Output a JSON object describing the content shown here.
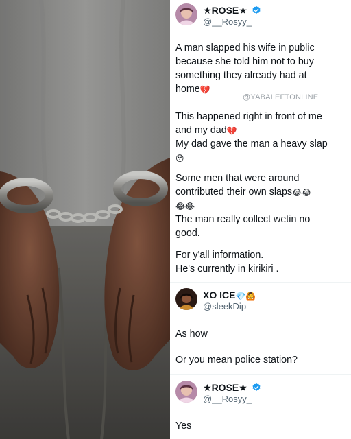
{
  "watermark": "@YABALEFTONLINE",
  "post1": {
    "display_name": "ROSE",
    "name_star": "★",
    "handle": "@__Rosyy_",
    "lines": [
      "A man slapped his wife in public",
      "because she told him not to buy",
      "something they already had at",
      "home",
      "This happened right in front of me",
      "and my dad",
      "My dad gave the man a heavy slap",
      "",
      "Some men that were around",
      "contributed their own slaps",
      "",
      "The man really collect wetin no",
      "good.",
      "For y'all information.",
      "He's currently in kirikiri ."
    ],
    "emoji": {
      "broken_heart": "💔",
      "shocked": "😯",
      "laughing_crying": "😂"
    }
  },
  "post2": {
    "display_name": "XO ICE",
    "name_badges": "💎🙆",
    "handle": "@sleekDip",
    "lines": [
      "As how",
      "Or you mean police station?"
    ]
  },
  "post3": {
    "display_name": "ROSE",
    "name_star": "★",
    "handle": "@__Rosyy_",
    "lines": [
      "Yes"
    ]
  },
  "colors": {
    "verified_blue": "#1d9bf0",
    "handle_gray": "#536471",
    "text": "#0f1419"
  }
}
